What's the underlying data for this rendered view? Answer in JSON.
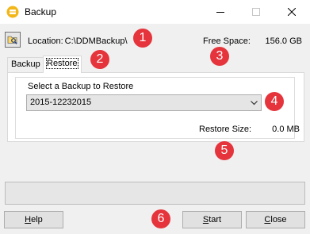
{
  "window": {
    "title": "Backup",
    "controls": {
      "minimize_icon": "minimize-icon",
      "maximize_icon": "maximize-icon",
      "close_icon": "close-icon"
    }
  },
  "location": {
    "label": "Location:",
    "path": "C:\\DDMBackup\\",
    "browse_icon": "folder-browse-icon"
  },
  "free_space": {
    "label": "Free Space:",
    "value": "156.0 GB"
  },
  "tabs": [
    {
      "label": "Backup",
      "active": false
    },
    {
      "label": "Restore",
      "active": true
    }
  ],
  "restore": {
    "select_label": "Select a Backup to Restore",
    "selected_backup": "2015-12232015",
    "size_label": "Restore Size:",
    "size_value": "0.0 MB"
  },
  "progress": {
    "value": 0
  },
  "buttons": {
    "help": {
      "underline": "H",
      "rest": "elp"
    },
    "start": {
      "underline": "S",
      "rest": "tart"
    },
    "close": {
      "underline": "C",
      "rest": "lose"
    }
  },
  "callouts": [
    "1",
    "2",
    "3",
    "4",
    "5",
    "6"
  ],
  "colors": {
    "callout": "#e5343b",
    "accent": "#06b025"
  }
}
